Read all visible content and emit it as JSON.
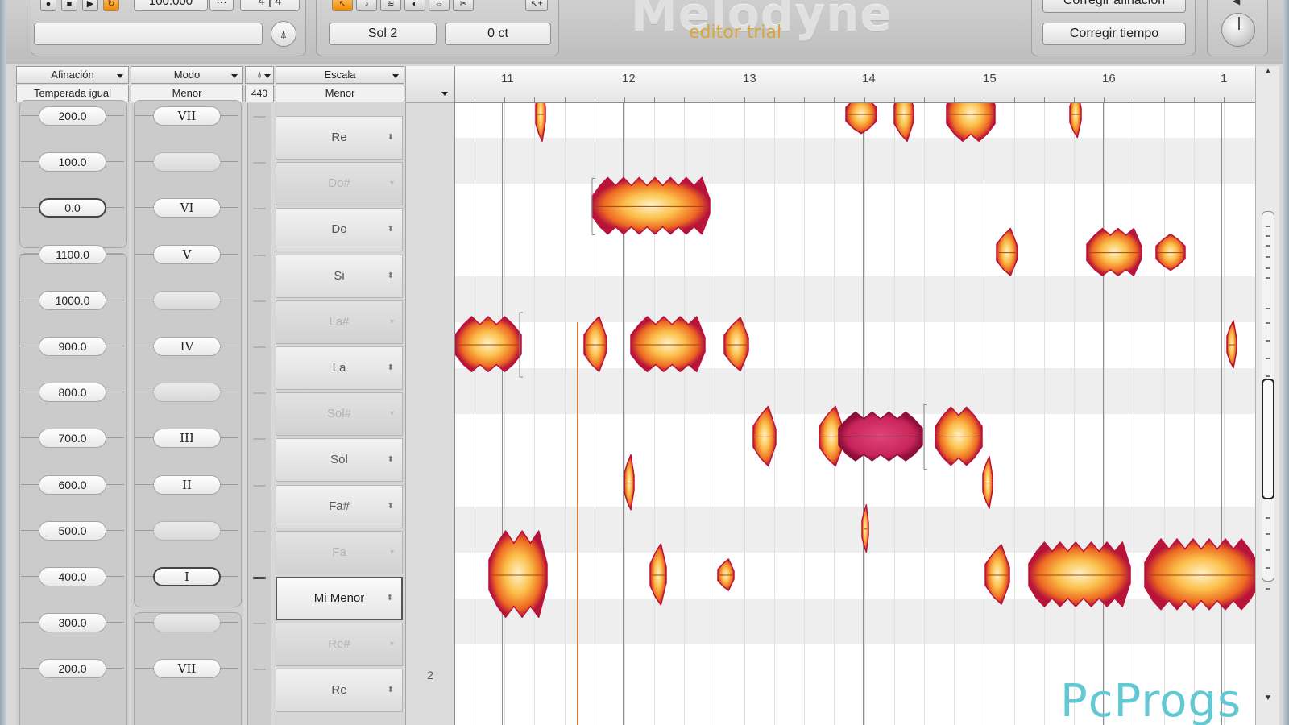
{
  "app": {
    "name": "Melodyne",
    "edition": "editor trial"
  },
  "transport": {
    "tempo": "100.000",
    "tempo_menu": "...",
    "time_signature": "4 | 4",
    "clip_name": ""
  },
  "pitch_info": {
    "note": "Sol 2",
    "cents": "0 ct"
  },
  "correction": {
    "pitch_button": "Corregir afinación",
    "time_button": "Corregir tiempo"
  },
  "columns": {
    "tuning": {
      "header": "Afinación",
      "value": "Temperada igual"
    },
    "mode": {
      "header": "Modo",
      "value": "Menor"
    },
    "reference": {
      "header": "",
      "value": "440"
    },
    "scale": {
      "header": "Escala",
      "value": "Menor"
    }
  },
  "cents": [
    "200.0",
    "100.0",
    "0.0",
    "1100.0",
    "1000.0",
    "900.0",
    "800.0",
    "700.0",
    "600.0",
    "500.0",
    "400.0",
    "300.0",
    "200.0"
  ],
  "degrees": [
    "VII",
    "",
    "VI",
    "V",
    "",
    "IV",
    "",
    "III",
    "II",
    "",
    "I",
    "",
    "VII"
  ],
  "scale_notes": [
    {
      "label": "Re",
      "state": "on"
    },
    {
      "label": "Do#",
      "state": "off"
    },
    {
      "label": "Do",
      "state": "on"
    },
    {
      "label": "Si",
      "state": "on"
    },
    {
      "label": "La#",
      "state": "off"
    },
    {
      "label": "La",
      "state": "on"
    },
    {
      "label": "Sol#",
      "state": "off"
    },
    {
      "label": "Sol",
      "state": "on"
    },
    {
      "label": "Fa#",
      "state": "on"
    },
    {
      "label": "Fa",
      "state": "off"
    },
    {
      "label": "Mi Menor",
      "state": "key"
    },
    {
      "label": "Re#",
      "state": "off"
    },
    {
      "label": "Re",
      "state": "on"
    }
  ],
  "octave_number": "2",
  "ruler": [
    "11",
    "12",
    "13",
    "14",
    "15",
    "16",
    "1"
  ],
  "watermark": "PcProgs",
  "colors": {
    "blob_outer": "#b8143a",
    "blob_mid": "#f07a1e",
    "blob_core": "#fff3c8",
    "selected_blob": "#c8245a",
    "playhead": "#d47a3a",
    "logo_sub": "#d9a53a",
    "watermark": "#63c8d2"
  },
  "icons": [
    "record-icon",
    "stop-icon",
    "play-icon",
    "loop-icon",
    "tuning-fork-icon",
    "pointer-tool-icon",
    "pitch-tool-icon",
    "formant-tool-icon",
    "amplitude-tool-icon",
    "time-tool-icon",
    "separation-tool-icon",
    "macro-icon",
    "speaker-icon"
  ]
}
